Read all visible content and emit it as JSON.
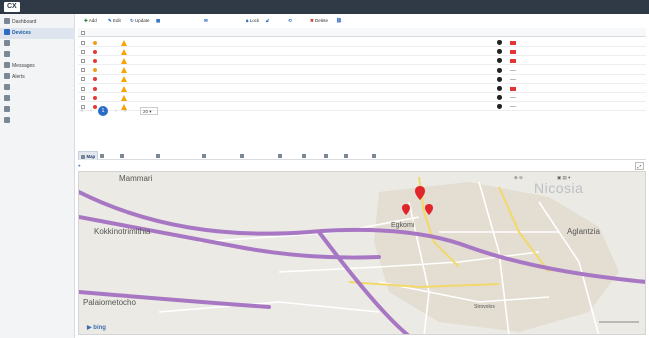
{
  "app": {
    "logo": "CX",
    "title": "",
    "user_info_prefix": "",
    "user_info_link": "",
    "user_info_rest": "",
    "user_info_tail": ""
  },
  "sidebar": {
    "items": [
      {
        "label": "Dashboard",
        "active": false
      },
      {
        "label": "Devices",
        "active": true
      },
      {
        "label": "",
        "active": false
      },
      {
        "label": "",
        "active": false
      },
      {
        "label": "Messages",
        "active": false
      },
      {
        "label": "Alerts",
        "active": false
      },
      {
        "label": "",
        "active": false
      },
      {
        "label": "",
        "active": false
      },
      {
        "label": "",
        "active": false
      },
      {
        "label": "",
        "active": false
      }
    ]
  },
  "toolbar": {
    "buttons": [
      {
        "label": "Add"
      },
      {
        "label": "Edit"
      },
      {
        "label": "Update"
      },
      {
        "label": ""
      },
      {
        "label": ""
      },
      {
        "label": "Lock"
      },
      {
        "label": ""
      },
      {
        "label": ""
      },
      {
        "label": "Delete"
      },
      {
        "label": ""
      }
    ]
  },
  "table": {
    "columns": [
      "",
      "",
      "",
      "",
      "",
      "",
      "",
      "",
      "",
      "",
      ""
    ],
    "rows": [
      {
        "status": "#f59a1b",
        "name": "",
        "group": "",
        "username": "",
        "phone": "",
        "flag": "red",
        "version": "",
        "updated": "",
        "lastalert": ""
      },
      {
        "status": "#e53935",
        "name": "",
        "group": "",
        "username": "",
        "phone": "",
        "flag": "red",
        "version": "",
        "updated": "",
        "lastalert": ""
      },
      {
        "status": "#e53935",
        "name": "",
        "group": "",
        "username": "",
        "phone": "",
        "flag": "red",
        "version": "",
        "updated": "",
        "lastalert": ""
      },
      {
        "status": "#f59a1b",
        "name": "",
        "group": "",
        "username": "",
        "phone": "",
        "flag": "gray",
        "version": "",
        "updated": "",
        "lastalert": ""
      },
      {
        "status": "#e53935",
        "name": "",
        "group": "",
        "username": "",
        "phone": "",
        "flag": "gray",
        "version": "",
        "updated": "",
        "lastalert": ""
      },
      {
        "status": "#e53935",
        "name": "",
        "group": "",
        "username": "",
        "phone": "",
        "flag": "red",
        "version": "",
        "updated": "",
        "lastalert": ""
      },
      {
        "status": "#e53935",
        "name": "",
        "group": "",
        "username": "",
        "phone": "",
        "flag": "gray",
        "version": "",
        "updated": "",
        "lastalert": ""
      },
      {
        "status": "#e53935",
        "name": "",
        "group": "",
        "username": "",
        "phone": "",
        "flag": "gray",
        "version": "",
        "updated": "",
        "lastalert": ""
      }
    ]
  },
  "pager": {
    "current": "1",
    "page_size": "20",
    "page_size_label": "",
    "count": ""
  },
  "detail_tabs": [
    {
      "label": "Map",
      "active": true
    },
    {
      "label": "",
      "active": false
    },
    {
      "label": "",
      "active": false
    },
    {
      "label": "",
      "active": false
    },
    {
      "label": "",
      "active": false
    },
    {
      "label": "",
      "active": false
    },
    {
      "label": "",
      "active": false
    },
    {
      "label": "",
      "active": false
    },
    {
      "label": "",
      "active": false
    },
    {
      "label": "",
      "active": false
    },
    {
      "label": "",
      "active": false
    }
  ],
  "map": {
    "current_location_label": "",
    "fullscreen_label": "",
    "labels": {
      "mammari": "Mammari",
      "kokkinotrimithia": "Kokkinotrimithia",
      "palaiometocho": "Palaiometocho",
      "egkomi": "Egkomi",
      "nicosia": "Nicosia",
      "aglantzia": "Aglantzia",
      "strovolos": "Strovolos"
    },
    "bing_label": "bing",
    "attribution": ""
  },
  "colors": {
    "topbar": "#2f3a46",
    "accent": "#2b6cc4",
    "highway": "#a877c4",
    "pin": "#e0262b"
  }
}
